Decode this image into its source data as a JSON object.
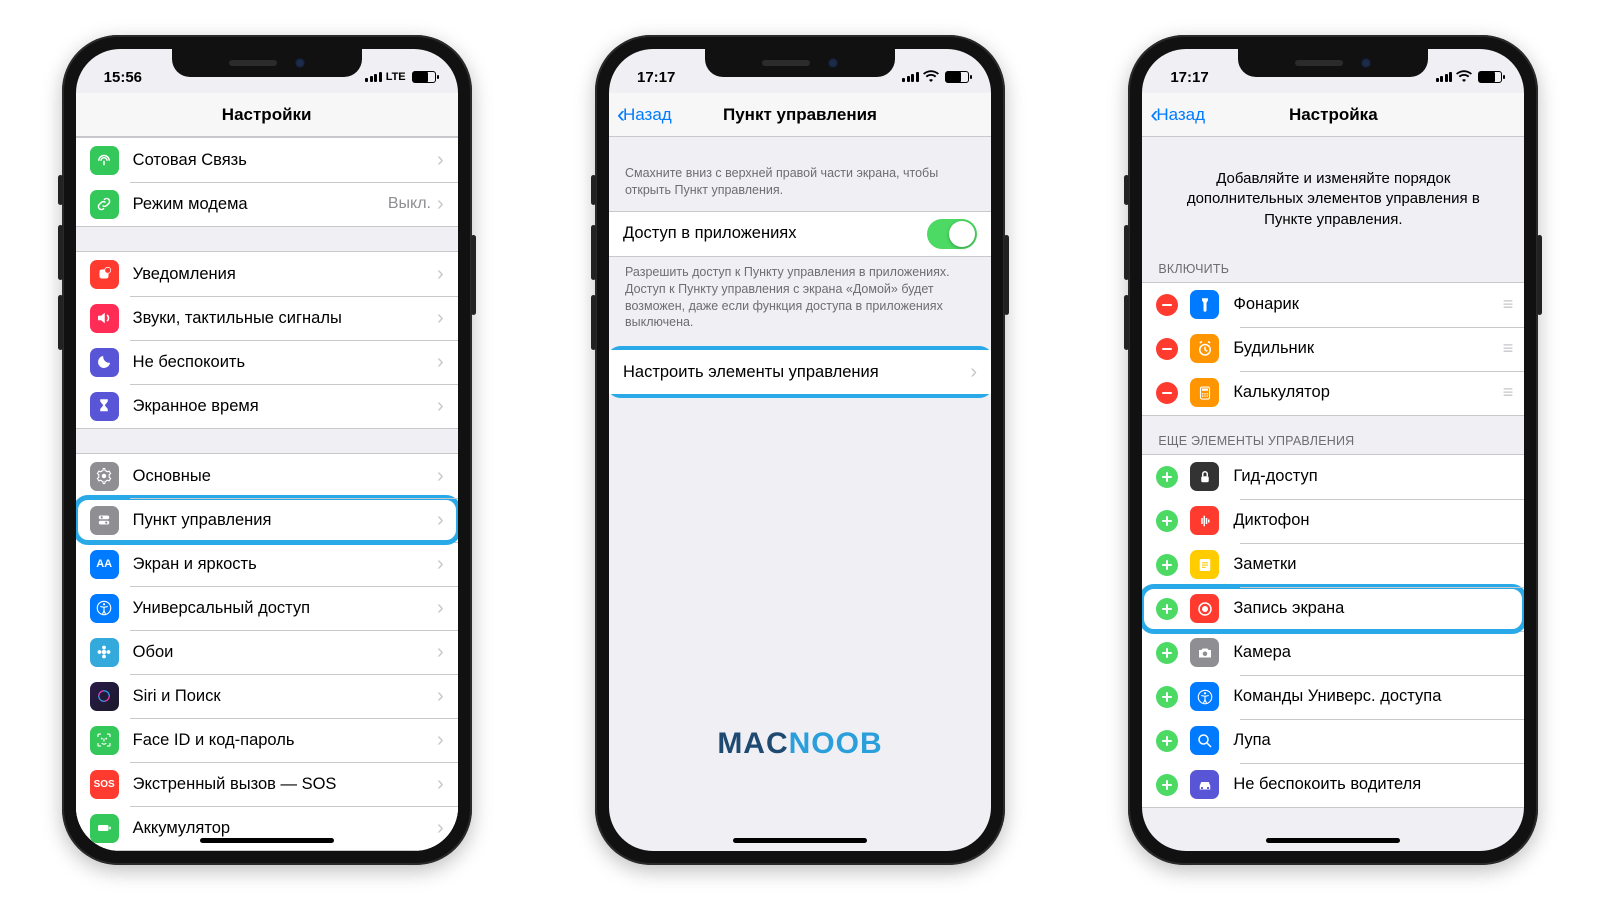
{
  "phone1": {
    "time": "15:56",
    "lte": "LTE",
    "title": "Настройки",
    "rows": {
      "cellular": "Сотовая Связь",
      "hotspot": "Режим модема",
      "hotspot_detail": "Выкл.",
      "notifications": "Уведомления",
      "sounds": "Звуки, тактильные сигналы",
      "dnd": "Не беспокоить",
      "screentime": "Экранное время",
      "general": "Основные",
      "control": "Пункт управления",
      "display": "Экран и яркость",
      "accessibility": "Универсальный доступ",
      "wallpaper": "Обои",
      "siri": "Siri и Поиск",
      "faceid": "Face ID и код-пароль",
      "sos": "Экстренный вызов — SOS",
      "battery": "Аккумулятор"
    }
  },
  "phone2": {
    "time": "17:17",
    "back": "Назад",
    "title": "Пункт управления",
    "hint1": "Смахните вниз с верхней правой части экрана, чтобы открыть Пункт управления.",
    "access_label": "Доступ в приложениях",
    "hint2": "Разрешить доступ к Пункту управления в приложениях. Доступ к Пункту управления с экрана «Домой» будет возможен, даже если функция доступа в приложениях выключена.",
    "customize": "Настроить элементы управления"
  },
  "phone3": {
    "time": "17:17",
    "back": "Назад",
    "title": "Настройка",
    "intro": "Добавляйте и изменяйте порядок дополнительных элементов управления в Пункте управления.",
    "include_header": "Включить",
    "include": {
      "flashlight": "Фонарик",
      "alarm": "Будильник",
      "calc": "Калькулятор"
    },
    "more_header": "Еще элементы управления",
    "more": {
      "guided": "Гид-доступ",
      "voice": "Диктофон",
      "notes": "Заметки",
      "record": "Запись экрана",
      "camera": "Камера",
      "ax": "Команды Универс. доступа",
      "magnifier": "Лупа",
      "drive": "Не беспокоить водителя"
    }
  },
  "watermark": {
    "a": "MAC",
    "b": "NOOB"
  }
}
